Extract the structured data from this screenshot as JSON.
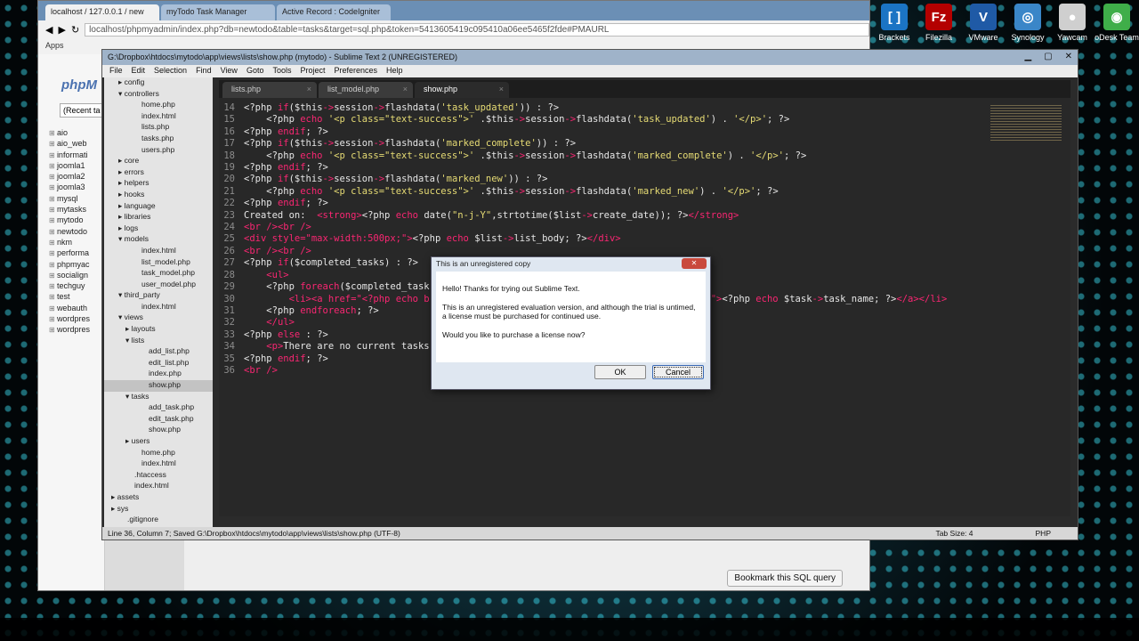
{
  "desktop_icons": [
    {
      "label": "Brackets",
      "icon": "brackets-icon",
      "color": "#1b74c4",
      "glyph": "[ ]"
    },
    {
      "label": "Filezilla",
      "icon": "filezilla-icon",
      "color": "#b40000",
      "glyph": "Fz"
    },
    {
      "label": "VMware",
      "icon": "vmware-icon",
      "color": "#1f5aa6",
      "glyph": "V"
    },
    {
      "label": "Synology",
      "icon": "synology-icon",
      "color": "#3a86c8",
      "glyph": "◎"
    },
    {
      "label": "Yawcam",
      "icon": "yawcam-icon",
      "color": "#cfcfcf",
      "glyph": "●"
    },
    {
      "label": "oDesk Team",
      "icon": "odesk-icon",
      "color": "#3fae49",
      "glyph": "◉"
    }
  ],
  "browser": {
    "tabs": [
      "localhost / 127.0.0.1 / new",
      "myTodo Task Manager",
      "Active Record : CodeIgniter"
    ],
    "url": "localhost/phpmyadmin/index.php?db=newtodo&table=tasks&target=sql.php&token=5413605419c095410a06ee5465f2fde#PMAURL",
    "bookmarks_label": "Apps",
    "pma_logo": "phpM",
    "pma_recent": "(Recent ta",
    "databases": [
      "aio",
      "aio_web",
      "informati",
      "joomla1",
      "joomla2",
      "joomla3",
      "mysql",
      "mytasks",
      "mytodo",
      "newtodo",
      "nkm",
      "performa",
      "phpmyac",
      "socialign",
      "techguy",
      "test",
      "webauth",
      "wordpres",
      "wordpres"
    ],
    "bookmark_button": "Bookmark this SQL query"
  },
  "sublime": {
    "title": "G:\\Dropbox\\htdocs\\mytodo\\app\\views\\lists\\show.php (mytodo) - Sublime Text 2 (UNREGISTERED)",
    "menu": [
      "File",
      "Edit",
      "Selection",
      "Find",
      "View",
      "Goto",
      "Tools",
      "Project",
      "Preferences",
      "Help"
    ],
    "tree": [
      {
        "label": "config",
        "indent": 2,
        "arrow": "▸"
      },
      {
        "label": "controllers",
        "indent": 2,
        "arrow": "▾"
      },
      {
        "label": "home.php",
        "indent": 4,
        "arrow": ""
      },
      {
        "label": "index.html",
        "indent": 4,
        "arrow": ""
      },
      {
        "label": "lists.php",
        "indent": 4,
        "arrow": ""
      },
      {
        "label": "tasks.php",
        "indent": 4,
        "arrow": ""
      },
      {
        "label": "users.php",
        "indent": 4,
        "arrow": ""
      },
      {
        "label": "core",
        "indent": 2,
        "arrow": "▸"
      },
      {
        "label": "errors",
        "indent": 2,
        "arrow": "▸"
      },
      {
        "label": "helpers",
        "indent": 2,
        "arrow": "▸"
      },
      {
        "label": "hooks",
        "indent": 2,
        "arrow": "▸"
      },
      {
        "label": "language",
        "indent": 2,
        "arrow": "▸"
      },
      {
        "label": "libraries",
        "indent": 2,
        "arrow": "▸"
      },
      {
        "label": "logs",
        "indent": 2,
        "arrow": "▸"
      },
      {
        "label": "models",
        "indent": 2,
        "arrow": "▾"
      },
      {
        "label": "index.html",
        "indent": 4,
        "arrow": ""
      },
      {
        "label": "list_model.php",
        "indent": 4,
        "arrow": ""
      },
      {
        "label": "task_model.php",
        "indent": 4,
        "arrow": ""
      },
      {
        "label": "user_model.php",
        "indent": 4,
        "arrow": ""
      },
      {
        "label": "third_party",
        "indent": 2,
        "arrow": "▾"
      },
      {
        "label": "index.html",
        "indent": 4,
        "arrow": ""
      },
      {
        "label": "views",
        "indent": 2,
        "arrow": "▾"
      },
      {
        "label": "layouts",
        "indent": 3,
        "arrow": "▸"
      },
      {
        "label": "lists",
        "indent": 3,
        "arrow": "▾"
      },
      {
        "label": "add_list.php",
        "indent": 5,
        "arrow": ""
      },
      {
        "label": "edit_list.php",
        "indent": 5,
        "arrow": ""
      },
      {
        "label": "index.php",
        "indent": 5,
        "arrow": ""
      },
      {
        "label": "show.php",
        "indent": 5,
        "arrow": "",
        "selected": true
      },
      {
        "label": "tasks",
        "indent": 3,
        "arrow": "▾"
      },
      {
        "label": "add_task.php",
        "indent": 5,
        "arrow": ""
      },
      {
        "label": "edit_task.php",
        "indent": 5,
        "arrow": ""
      },
      {
        "label": "show.php",
        "indent": 5,
        "arrow": ""
      },
      {
        "label": "users",
        "indent": 3,
        "arrow": "▸"
      },
      {
        "label": "home.php",
        "indent": 4,
        "arrow": ""
      },
      {
        "label": "index.html",
        "indent": 4,
        "arrow": ""
      },
      {
        "label": ".htaccess",
        "indent": 3,
        "arrow": ""
      },
      {
        "label": "index.html",
        "indent": 3,
        "arrow": ""
      },
      {
        "label": "assets",
        "indent": 1,
        "arrow": "▸"
      },
      {
        "label": "sys",
        "indent": 1,
        "arrow": "▸"
      },
      {
        "label": ".gitignore",
        "indent": 2,
        "arrow": ""
      }
    ],
    "tabs": [
      "lists.php",
      "list_model.php",
      "show.php"
    ],
    "active_tab": 2,
    "code": [
      {
        "n": "14",
        "text": "<?php if($this->session->flashdata('task_updated')) : ?>"
      },
      {
        "n": "15",
        "text": "    <?php echo '<p class=\"text-success\">' .$this->session->flashdata('task_updated') . '</p>'; ?>"
      },
      {
        "n": "16",
        "text": "<?php endif; ?>"
      },
      {
        "n": "17",
        "text": "<?php if($this->session->flashdata('marked_complete')) : ?>"
      },
      {
        "n": "18",
        "text": "    <?php echo '<p class=\"text-success\">' .$this->session->flashdata('marked_complete') . '</p>'; ?>"
      },
      {
        "n": "19",
        "text": "<?php endif; ?>"
      },
      {
        "n": "20",
        "text": "<?php if($this->session->flashdata('marked_new')) : ?>"
      },
      {
        "n": "21",
        "text": "    <?php echo '<p class=\"text-success\">' .$this->session->flashdata('marked_new') . '</p>'; ?>"
      },
      {
        "n": "22",
        "text": "<?php endif; ?>"
      },
      {
        "n": "23",
        "text": "Created on:  <strong><?php echo date(\"n-j-Y\",strtotime($list->create_date)); ?></strong>"
      },
      {
        "n": "24",
        "text": "<br /><br />"
      },
      {
        "n": "25",
        "text": "<div style=\"max-width:500px;\"><?php echo $list->list_body; ?></div>"
      },
      {
        "n": "26",
        "text": "<br /><br />"
      },
      {
        "n": "27",
        "text": "<?php if($completed_tasks) : ?>"
      },
      {
        "n": "28",
        "text": "    <ul>"
      },
      {
        "n": "29",
        "text": "    <?php foreach($completed_task"
      },
      {
        "n": "30",
        "text": "        <li><a href=\"<?php echo b                                                  \"><?php echo $task->task_name; ?></a></li>"
      },
      {
        "n": "31",
        "text": "    <?php endforeach; ?>"
      },
      {
        "n": "32",
        "text": "    </ul>"
      },
      {
        "n": "33",
        "text": "<?php else : ?>"
      },
      {
        "n": "34",
        "text": "    <p>There are no current tasks"
      },
      {
        "n": "35",
        "text": "<?php endif; ?>"
      },
      {
        "n": "36",
        "text": "<br />"
      }
    ],
    "status_left": "Line 36, Column 7; Saved G:\\Dropbox\\htdocs\\mytodo\\app\\views\\lists\\show.php (UTF-8)",
    "status_tab": "Tab Size: 4",
    "status_syntax": "PHP"
  },
  "dialog": {
    "title": "This is an unregistered copy",
    "line1": "Hello! Thanks for trying out Sublime Text.",
    "line2": "This is an unregistered evaluation version, and although the trial is untimed, a license must be purchased for continued use.",
    "line3": "Would you like to purchase a license now?",
    "ok": "OK",
    "cancel": "Cancel"
  }
}
